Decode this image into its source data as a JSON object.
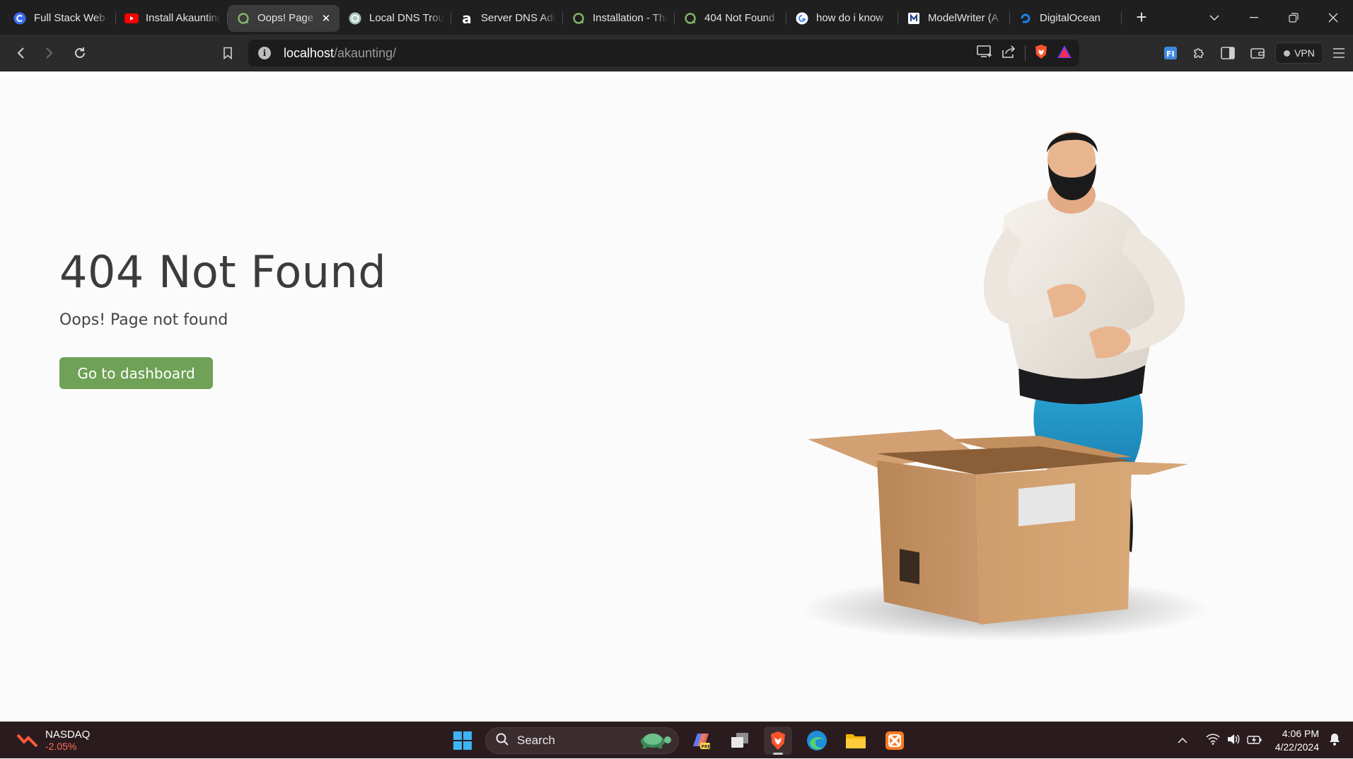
{
  "browser": {
    "tabs": [
      {
        "title": "Full Stack Web Development",
        "favicon": "c-circle-icon"
      },
      {
        "title": "Install Akaunting",
        "favicon": "youtube-icon"
      },
      {
        "title": "Oops! Page not found",
        "favicon": "akaunting-icon",
        "active": true
      },
      {
        "title": "Local DNS Troubleshooting",
        "favicon": "chatgpt-icon"
      },
      {
        "title": "Server DNS Address",
        "favicon": "amazon-a-icon"
      },
      {
        "title": "Installation - The",
        "favicon": "akaunting-icon"
      },
      {
        "title": "404 Not Found",
        "favicon": "akaunting-icon"
      },
      {
        "title": "how do i know",
        "favicon": "google-icon"
      },
      {
        "title": "ModelWriter (A",
        "favicon": "modelwriter-icon"
      },
      {
        "title": "DigitalOcean",
        "favicon": "digitalocean-icon"
      }
    ],
    "address": {
      "host": "localhost",
      "path": "/akaunting/"
    },
    "vpn_label": "VPN"
  },
  "page": {
    "heading": "404 Not Found",
    "subtitle": "Oops! Page not found",
    "button_label": "Go to dashboard",
    "accent_color": "#6fa156"
  },
  "taskbar": {
    "widget": {
      "name": "NASDAQ",
      "change": "-2.05%"
    },
    "search_label": "Search",
    "time": "4:06 PM",
    "date": "4/22/2024"
  }
}
